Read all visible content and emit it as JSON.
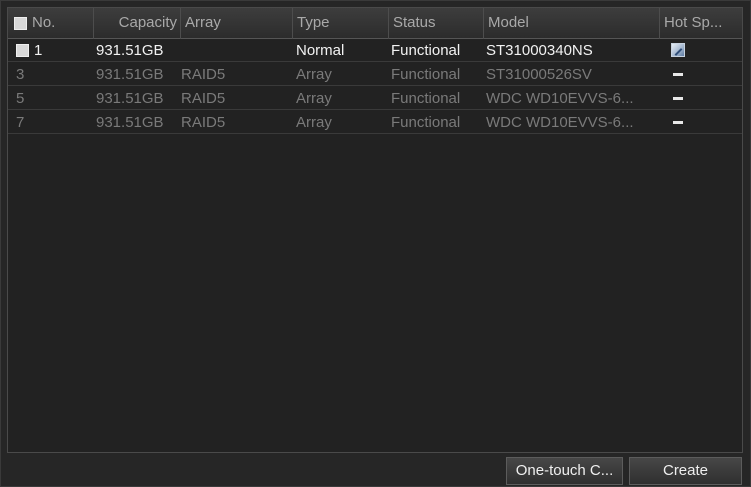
{
  "table": {
    "headers": {
      "no": "No.",
      "capacity": "Capacity",
      "array": "Array",
      "type": "Type",
      "status": "Status",
      "model": "Model",
      "hot_spare": "Hot Sp..."
    },
    "rows": [
      {
        "no": "1",
        "capacity": "931.51GB",
        "array": "",
        "type": "Normal",
        "status": "Functional",
        "model": "ST31000340NS",
        "hot_spare_icon": "edit-icon",
        "selectable": true
      },
      {
        "no": "3",
        "capacity": "931.51GB",
        "array": "RAID5",
        "type": "Array",
        "status": "Functional",
        "model": "ST31000526SV",
        "hot_spare_icon": "dash-icon",
        "selectable": false
      },
      {
        "no": "5",
        "capacity": "931.51GB",
        "array": "RAID5",
        "type": "Array",
        "status": "Functional",
        "model": "WDC WD10EVVS-6...",
        "hot_spare_icon": "dash-icon",
        "selectable": false
      },
      {
        "no": "7",
        "capacity": "931.51GB",
        "array": "RAID5",
        "type": "Array",
        "status": "Functional",
        "model": "WDC WD10EVVS-6...",
        "hot_spare_icon": "dash-icon",
        "selectable": false
      }
    ]
  },
  "buttons": {
    "one_touch": "One-touch C...",
    "create": "Create"
  },
  "colors": {
    "panel_bg": "#262626",
    "active_text": "#f2f2f2",
    "dim_text": "#7a7a7a"
  }
}
